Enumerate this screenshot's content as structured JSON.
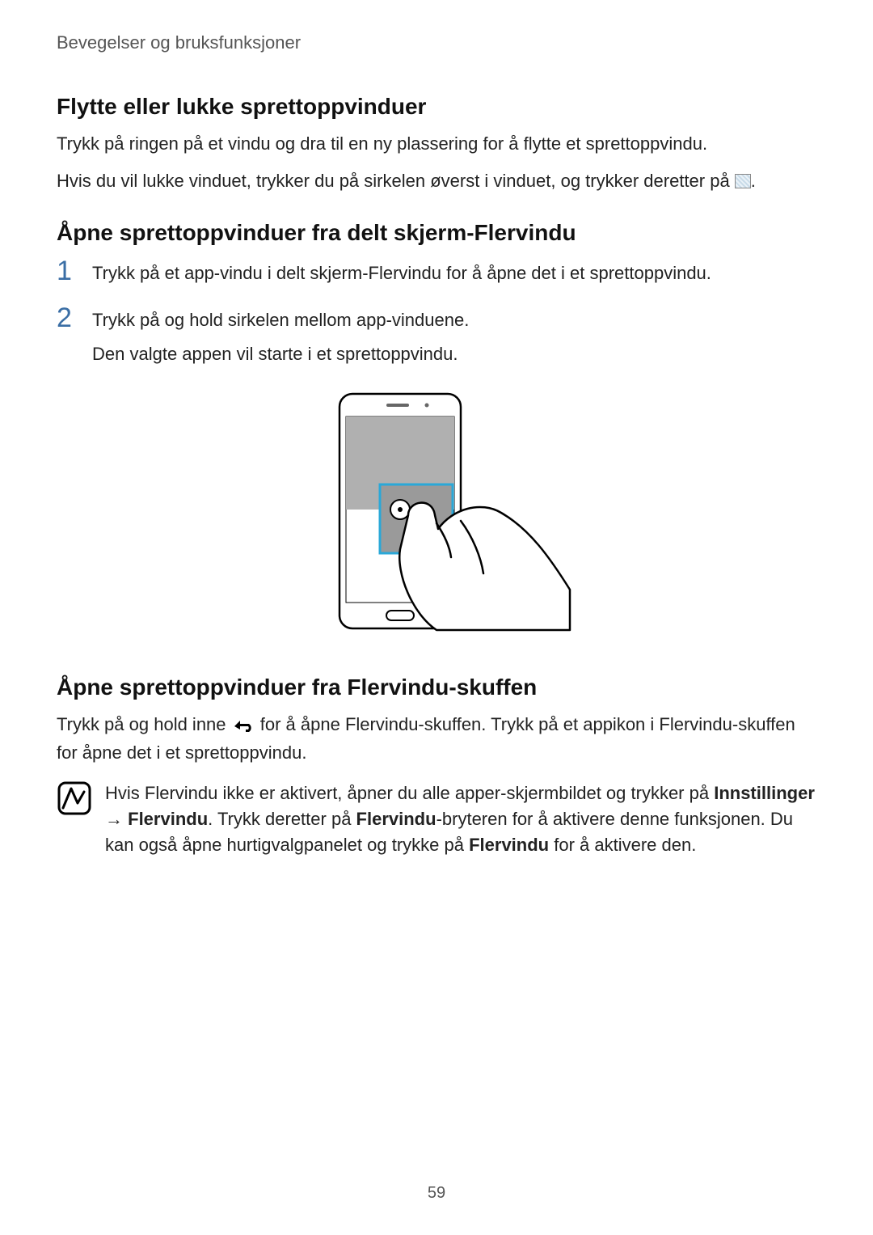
{
  "chapter": "Bevegelser og bruksfunksjoner",
  "section1": {
    "heading": "Flytte eller lukke sprettoppvinduer",
    "p1": "Trykk på ringen på et vindu og dra til en ny plassering for å flytte et sprettoppvindu.",
    "p2a": "Hvis du vil lukke vinduet, trykker du på sirkelen øverst i vinduet, og trykker deretter på ",
    "p2b": "."
  },
  "section2": {
    "heading": "Åpne sprettoppvinduer fra delt skjerm-Flervindu",
    "step1": "Trykk på et app-vindu i delt skjerm-Flervindu for å åpne det i et sprettoppvindu.",
    "step2a": "Trykk på og hold sirkelen mellom app-vinduene.",
    "step2b": "Den valgte appen vil starte i et sprettoppvindu."
  },
  "section3": {
    "heading": "Åpne sprettoppvinduer fra Flervindu-skuffen",
    "p1a": "Trykk på og hold inne ",
    "p1b": " for å åpne Flervindu-skuffen. Trykk på et appikon i Flervindu-skuffen for åpne det i et sprettoppvindu."
  },
  "note": {
    "t1": "Hvis Flervindu ikke er aktivert, åpner du alle apper-skjermbildet og trykker på ",
    "b1": "Innstillinger",
    "arrow": " → ",
    "b2": "Flervindu",
    "t2": ". Trykk deretter på ",
    "b3": "Flervindu",
    "t3": "-bryteren for å aktivere denne funksjonen. Du kan også åpne hurtigvalgpanelet og trykke på ",
    "b4": "Flervindu",
    "t4": " for å aktivere den."
  },
  "pagenum": "59"
}
